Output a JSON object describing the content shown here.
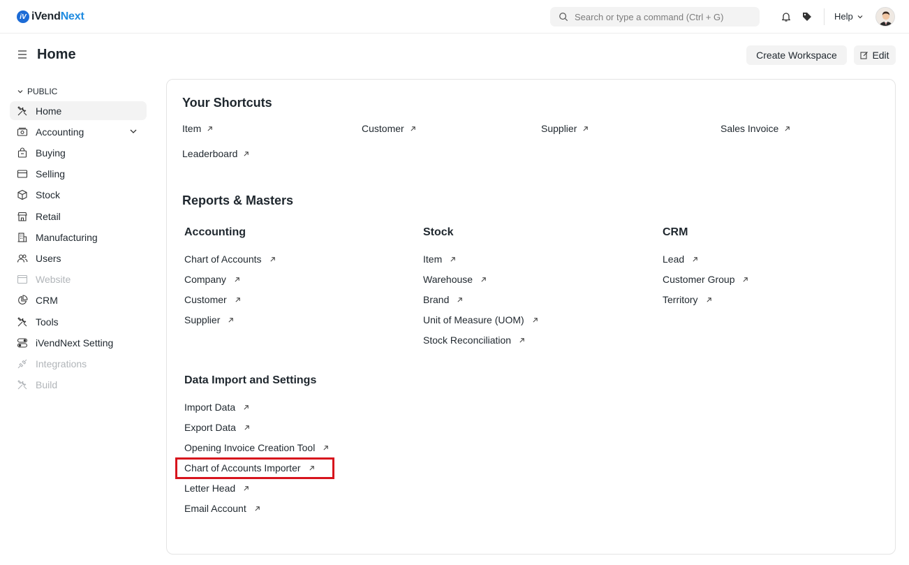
{
  "brand": {
    "mark": "iV",
    "name_part1": "iVend",
    "name_part2": "Next"
  },
  "search": {
    "placeholder": "Search or type a command (Ctrl + G)"
  },
  "navbar": {
    "help_label": "Help"
  },
  "page": {
    "title": "Home",
    "create_workspace_label": "Create Workspace",
    "edit_label": "Edit"
  },
  "sidebar": {
    "group_label": "PUBLIC",
    "items": [
      {
        "label": "Home",
        "icon": "tools-icon",
        "active": true
      },
      {
        "label": "Accounting",
        "icon": "accounting-icon",
        "expandable": true
      },
      {
        "label": "Buying",
        "icon": "buying-icon"
      },
      {
        "label": "Selling",
        "icon": "selling-icon"
      },
      {
        "label": "Stock",
        "icon": "stock-icon"
      },
      {
        "label": "Retail",
        "icon": "retail-icon"
      },
      {
        "label": "Manufacturing",
        "icon": "manufacturing-icon"
      },
      {
        "label": "Users",
        "icon": "users-icon"
      },
      {
        "label": "Website",
        "icon": "website-icon",
        "disabled": true
      },
      {
        "label": "CRM",
        "icon": "crm-icon"
      },
      {
        "label": "Tools",
        "icon": "tools-icon"
      },
      {
        "label": "iVendNext Setting",
        "icon": "settings-icon"
      },
      {
        "label": "Integrations",
        "icon": "integrations-icon",
        "disabled": true
      },
      {
        "label": "Build",
        "icon": "build-icon",
        "disabled": true
      }
    ]
  },
  "shortcuts": {
    "title": "Your Shortcuts",
    "items": [
      "Item",
      "Customer",
      "Supplier",
      "Sales Invoice",
      "Leaderboard"
    ]
  },
  "reports": {
    "title": "Reports & Masters",
    "cards": [
      {
        "title": "Accounting",
        "links": [
          "Chart of Accounts",
          "Company",
          "Customer",
          "Supplier"
        ]
      },
      {
        "title": "Stock",
        "links": [
          "Item",
          "Warehouse",
          "Brand",
          "Unit of Measure (UOM)",
          "Stock Reconciliation"
        ]
      },
      {
        "title": "CRM",
        "links": [
          "Lead",
          "Customer Group",
          "Territory"
        ]
      },
      {
        "title": "Data Import and Settings",
        "links": [
          "Import Data",
          "Export Data",
          "Opening Invoice Creation Tool",
          "Chart of Accounts Importer",
          "Letter Head",
          "Email Account"
        ]
      }
    ]
  },
  "colors": {
    "accent": "#1f8be0",
    "highlight_border": "#d7141d",
    "text": "#1f272e",
    "muted": "#b1b5b9"
  }
}
